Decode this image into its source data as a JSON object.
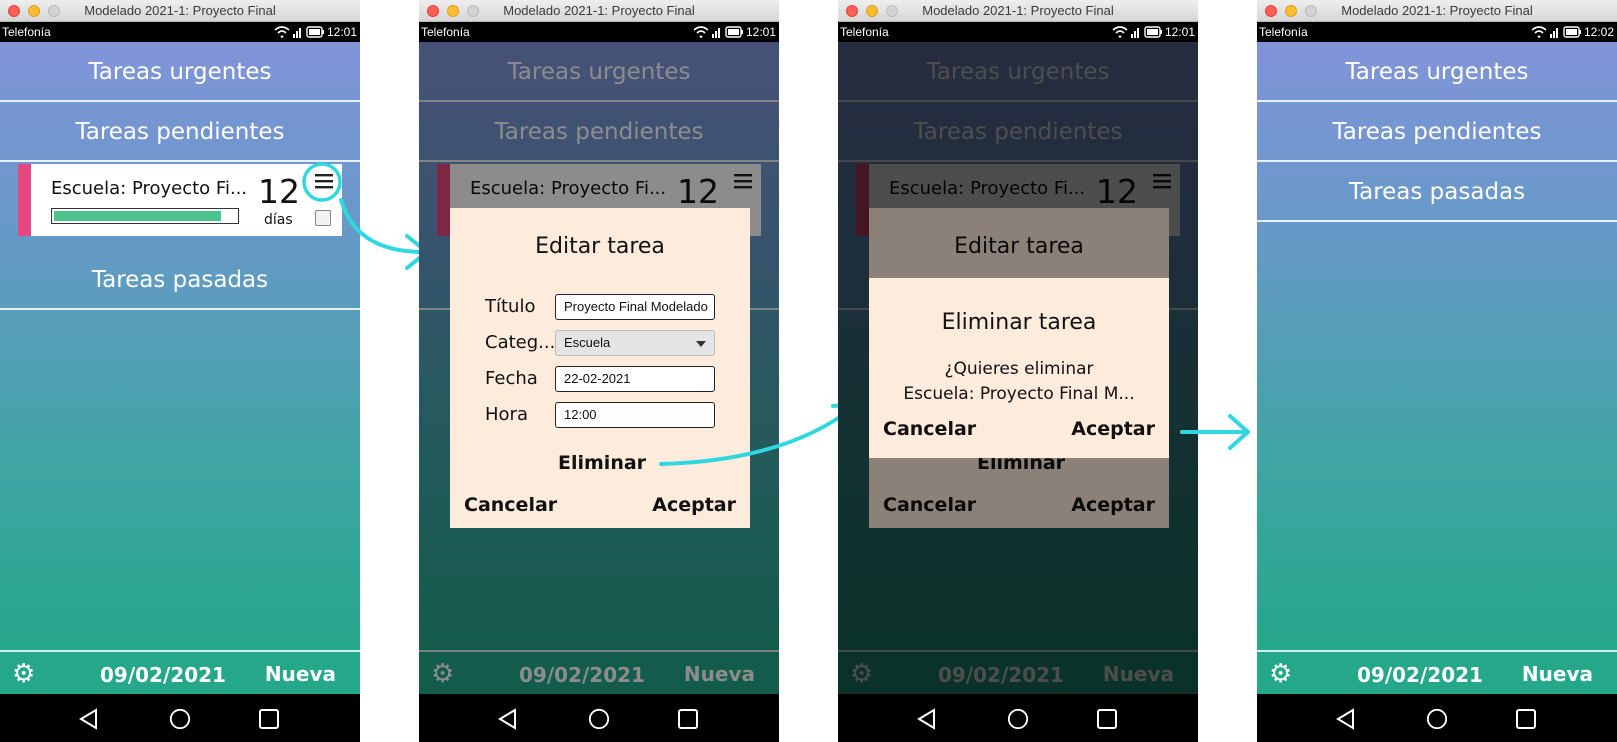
{
  "window_title": "Modelado 2021-1: Proyecto Final",
  "status_bar": {
    "carrier": "Telefonía",
    "icons": "wifi-signal-battery"
  },
  "clocks": [
    "12:01",
    "12:01",
    "12:01",
    "12:02"
  ],
  "sections": {
    "urgent": "Tareas urgentes",
    "pending": "Tareas pendientes",
    "past": "Tareas pasadas"
  },
  "task": {
    "title": "Escuela: Proyecto Fi...",
    "days_number": "12",
    "days_label": "días",
    "progress": 0.92,
    "category_color": "#e5477f"
  },
  "bottom_bar": {
    "date": "09/02/2021",
    "new_label": "Nueva",
    "settings_icon": "gear-icon"
  },
  "nav": {
    "back_icon": "back-triangle-icon",
    "home_icon": "home-circle-icon",
    "recents_icon": "recents-square-icon"
  },
  "edit_dialog": {
    "title": "Editar tarea",
    "labels": {
      "title": "Título",
      "category": "Categ...",
      "date": "Fecha",
      "time": "Hora"
    },
    "values": {
      "title": "Proyecto Final Modelado",
      "category": "Escuela",
      "date": "22-02-2021",
      "time": "12:00"
    },
    "delete_label": "Eliminar",
    "cancel_label": "Cancelar",
    "accept_label": "Aceptar"
  },
  "delete_dialog": {
    "title": "Eliminar tarea",
    "question": "¿Quieres eliminar",
    "task_name": "Escuela: Proyecto Final M...",
    "cancel_label": "Cancelar",
    "accept_label": "Aceptar"
  },
  "colors": {
    "annotation": "#2fd8e0",
    "dialog_bg": "#fdebdc",
    "bar_accent": "#24a889",
    "progress": "#4cc48e"
  }
}
